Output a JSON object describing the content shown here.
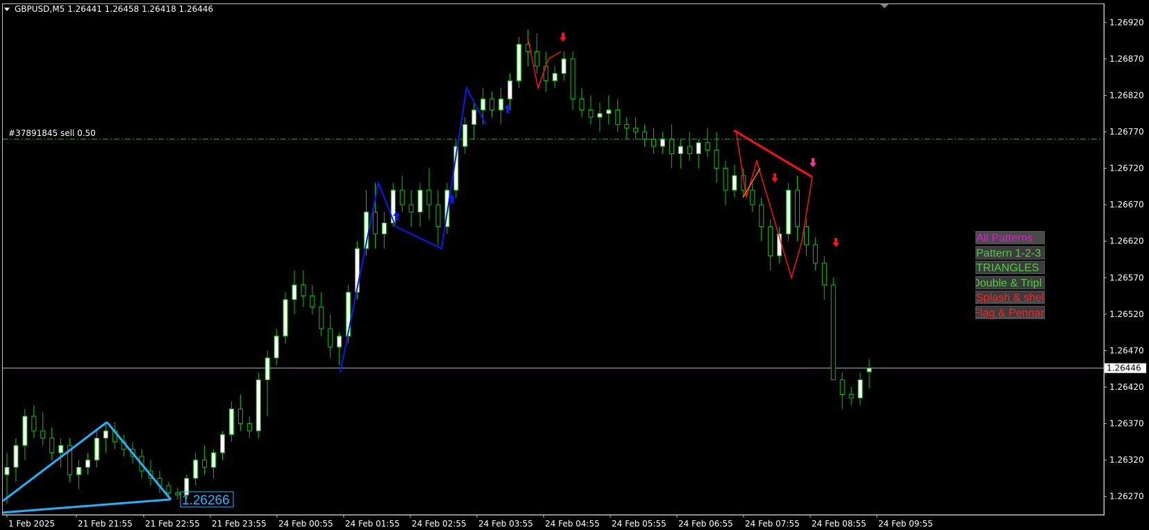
{
  "header": {
    "symbol": "GBPUSD,M5",
    "ohlc": "1.26441 1.26458 1.26418 1.26446"
  },
  "order": {
    "label": "#37891845 sell 0.50",
    "price": 1.2676
  },
  "current_price": {
    "label": "1.26446",
    "value": 1.26446
  },
  "pattern_price_label": "1.26266",
  "patterns_menu": {
    "items": [
      {
        "label": "All Patterns",
        "style": "all"
      },
      {
        "label": "Pattern 1-2-3",
        "style": "green"
      },
      {
        "label": "TRIANGLES",
        "style": "green"
      },
      {
        "label": "Double & Tripl",
        "style": "green"
      },
      {
        "label": "Splash & shel",
        "style": "red"
      },
      {
        "label": "Flag & Pennan",
        "style": "red"
      }
    ]
  },
  "price_axis": {
    "ticks": [
      "1.26920",
      "1.26870",
      "1.26820",
      "1.26770",
      "1.26720",
      "1.26670",
      "1.26620",
      "1.26570",
      "1.26520",
      "1.26470",
      "1.26420",
      "1.26370",
      "1.26320",
      "1.26270"
    ]
  },
  "time_axis": {
    "ticks": [
      "1 Feb 2025",
      "21 Feb 21:55",
      "21 Feb 22:55",
      "21 Feb 23:55",
      "24 Feb 00:55",
      "24 Feb 01:55",
      "24 Feb 02:55",
      "24 Feb 03:55",
      "24 Feb 04:55",
      "24 Feb 05:55",
      "24 Feb 06:55",
      "24 Feb 07:55",
      "24 Feb 08:55",
      "24 Feb 09:55"
    ]
  },
  "colors": {
    "background": "#000000",
    "bull_body": "#ffffff",
    "bear_body": "#000000",
    "candle_outline": "#00c800",
    "wick": "#00c800",
    "order_line": "#2d8f2d",
    "price_line": "#9fb9c8",
    "triangle_cyan": "#1fb4ff",
    "pattern_blue": "#0a18ff",
    "pattern_red": "#ff1010",
    "pattern_orange": "#ff7a00",
    "arrow_magenta": "#ff2fa8"
  },
  "chart_data": {
    "type": "candlestick",
    "symbol": "GBPUSD",
    "timeframe": "M5",
    "ylim": [
      1.26245,
      1.26945
    ],
    "candles": [
      [
        1.263,
        1.2633,
        1.2626,
        1.2631
      ],
      [
        1.2631,
        1.2635,
        1.2629,
        1.2634
      ],
      [
        1.2634,
        1.2639,
        1.2632,
        1.2638
      ],
      [
        1.2638,
        1.26395,
        1.2635,
        1.2636
      ],
      [
        1.2636,
        1.26385,
        1.2634,
        1.2635
      ],
      [
        1.2635,
        1.26365,
        1.2632,
        1.2633
      ],
      [
        1.2633,
        1.2635,
        1.2631,
        1.2634
      ],
      [
        1.2634,
        1.2635,
        1.2629,
        1.263
      ],
      [
        1.263,
        1.2632,
        1.2628,
        1.2631
      ],
      [
        1.2631,
        1.2633,
        1.263,
        1.2632
      ],
      [
        1.2632,
        1.2636,
        1.2631,
        1.2635
      ],
      [
        1.2635,
        1.2637,
        1.2633,
        1.2636
      ],
      [
        1.2636,
        1.26372,
        1.26335,
        1.26345
      ],
      [
        1.26345,
        1.26355,
        1.26325,
        1.26335
      ],
      [
        1.26335,
        1.26345,
        1.26315,
        1.26325
      ],
      [
        1.26325,
        1.26335,
        1.26295,
        1.26305
      ],
      [
        1.26305,
        1.2632,
        1.26285,
        1.26295
      ],
      [
        1.26295,
        1.26305,
        1.26275,
        1.26285
      ],
      [
        1.26285,
        1.2629,
        1.26268,
        1.26275
      ],
      [
        1.26275,
        1.26282,
        1.26266,
        1.26272
      ],
      [
        1.26272,
        1.263,
        1.26266,
        1.26295
      ],
      [
        1.26295,
        1.2633,
        1.26285,
        1.2632
      ],
      [
        1.2632,
        1.2634,
        1.263,
        1.2631
      ],
      [
        1.2631,
        1.26335,
        1.26295,
        1.2633
      ],
      [
        1.2633,
        1.2636,
        1.2632,
        1.26355
      ],
      [
        1.26355,
        1.264,
        1.26345,
        1.2639
      ],
      [
        1.2639,
        1.2641,
        1.2636,
        1.2637
      ],
      [
        1.2637,
        1.2638,
        1.2635,
        1.2636
      ],
      [
        1.2636,
        1.2644,
        1.2635,
        1.2643
      ],
      [
        1.2643,
        1.2647,
        1.2638,
        1.2646
      ],
      [
        1.2646,
        1.265,
        1.2645,
        1.2649
      ],
      [
        1.2649,
        1.2655,
        1.2648,
        1.2654
      ],
      [
        1.2654,
        1.2658,
        1.2652,
        1.2656
      ],
      [
        1.2656,
        1.2658,
        1.2653,
        1.26545
      ],
      [
        1.26545,
        1.2656,
        1.2652,
        1.2653
      ],
      [
        1.2653,
        1.2655,
        1.2649,
        1.265
      ],
      [
        1.265,
        1.2652,
        1.2646,
        1.26475
      ],
      [
        1.26475,
        1.26495,
        1.2645,
        1.2649
      ],
      [
        1.2649,
        1.2656,
        1.2648,
        1.2655
      ],
      [
        1.2655,
        1.2662,
        1.2654,
        1.2661
      ],
      [
        1.2661,
        1.2669,
        1.266,
        1.2666
      ],
      [
        1.2666,
        1.267,
        1.2661,
        1.2663
      ],
      [
        1.2663,
        1.2666,
        1.2661,
        1.26645
      ],
      [
        1.26645,
        1.267,
        1.2664,
        1.2669
      ],
      [
        1.2669,
        1.2671,
        1.2666,
        1.2667
      ],
      [
        1.2667,
        1.2669,
        1.2664,
        1.2666
      ],
      [
        1.2666,
        1.267,
        1.2664,
        1.2669
      ],
      [
        1.2669,
        1.2672,
        1.2665,
        1.2667
      ],
      [
        1.2667,
        1.2669,
        1.26615,
        1.2664
      ],
      [
        1.2664,
        1.267,
        1.2663,
        1.2669
      ],
      [
        1.2669,
        1.2676,
        1.2668,
        1.2675
      ],
      [
        1.2675,
        1.2679,
        1.2674,
        1.2678
      ],
      [
        1.2678,
        1.2681,
        1.2676,
        1.268
      ],
      [
        1.268,
        1.2683,
        1.2678,
        1.26815
      ],
      [
        1.26815,
        1.26825,
        1.2679,
        1.268
      ],
      [
        1.268,
        1.2683,
        1.2678,
        1.26815
      ],
      [
        1.26815,
        1.2685,
        1.268,
        1.2684
      ],
      [
        1.2684,
        1.269,
        1.2683,
        1.2689
      ],
      [
        1.2689,
        1.2691,
        1.2686,
        1.2688
      ],
      [
        1.2688,
        1.26905,
        1.2685,
        1.2686
      ],
      [
        1.2686,
        1.2688,
        1.26825,
        1.2684
      ],
      [
        1.2684,
        1.2686,
        1.2683,
        1.2685
      ],
      [
        1.2685,
        1.2688,
        1.2684,
        1.2687
      ],
      [
        1.2687,
        1.2688,
        1.268,
        1.26815
      ],
      [
        1.26815,
        1.2683,
        1.2679,
        1.268
      ],
      [
        1.268,
        1.2682,
        1.2678,
        1.2679
      ],
      [
        1.2679,
        1.2681,
        1.2677,
        1.26795
      ],
      [
        1.26795,
        1.2682,
        1.2678,
        1.268
      ],
      [
        1.268,
        1.26815,
        1.2677,
        1.2678
      ],
      [
        1.2678,
        1.2679,
        1.2676,
        1.26775
      ],
      [
        1.26775,
        1.2679,
        1.2676,
        1.2677
      ],
      [
        1.2677,
        1.2678,
        1.2675,
        1.2676
      ],
      [
        1.2676,
        1.26775,
        1.2674,
        1.2675
      ],
      [
        1.2675,
        1.2677,
        1.2674,
        1.2676
      ],
      [
        1.2676,
        1.2678,
        1.2672,
        1.2674
      ],
      [
        1.2674,
        1.2676,
        1.2672,
        1.2675
      ],
      [
        1.2675,
        1.2677,
        1.2673,
        1.2674
      ],
      [
        1.2674,
        1.2676,
        1.2672,
        1.26755
      ],
      [
        1.26755,
        1.26775,
        1.26735,
        1.26745
      ],
      [
        1.26745,
        1.2677,
        1.267,
        1.2672
      ],
      [
        1.2672,
        1.2673,
        1.2667,
        1.2669
      ],
      [
        1.2669,
        1.26725,
        1.2668,
        1.2671
      ],
      [
        1.2671,
        1.2672,
        1.2668,
        1.2669
      ],
      [
        1.2669,
        1.267,
        1.2666,
        1.2667
      ],
      [
        1.2667,
        1.2668,
        1.2662,
        1.2664
      ],
      [
        1.2664,
        1.2665,
        1.2658,
        1.266
      ],
      [
        1.266,
        1.2664,
        1.2659,
        1.2663
      ],
      [
        1.2663,
        1.267,
        1.2662,
        1.2669
      ],
      [
        1.2669,
        1.2671,
        1.2662,
        1.2664
      ],
      [
        1.2664,
        1.2665,
        1.266,
        1.26615
      ],
      [
        1.26615,
        1.26625,
        1.2658,
        1.2659
      ],
      [
        1.2659,
        1.266,
        1.2654,
        1.2656
      ],
      [
        1.2656,
        1.2657,
        1.2645,
        1.2643
      ],
      [
        1.2643,
        1.2644,
        1.2639,
        1.2641
      ],
      [
        1.2641,
        1.2642,
        1.26395,
        1.26405
      ],
      [
        1.26405,
        1.2644,
        1.26395,
        1.2643
      ],
      [
        1.26441,
        1.26458,
        1.26418,
        1.26446
      ]
    ]
  }
}
